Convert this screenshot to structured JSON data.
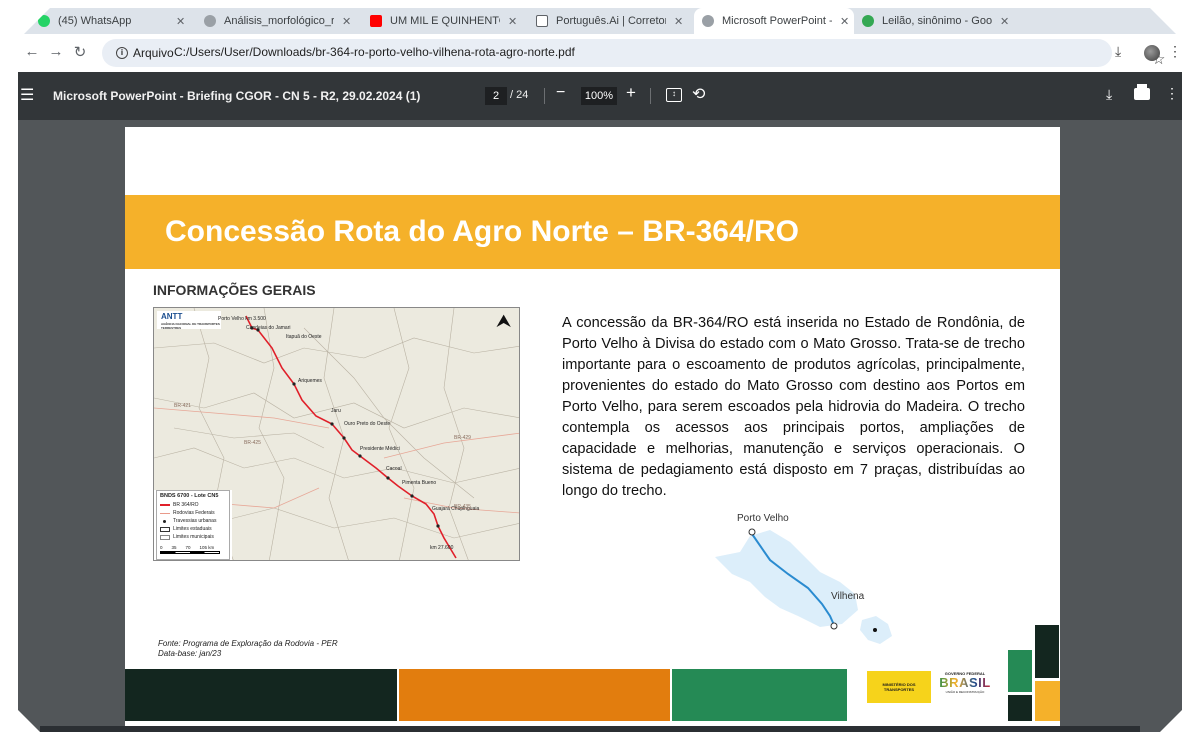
{
  "browser": {
    "tabs": [
      {
        "label": "(45) WhatsApp",
        "icon": "whatsapp-icon",
        "color": "#25d366"
      },
      {
        "label": "Análisis_morfológico_re",
        "icon": "globe-icon",
        "color": "#5f6368"
      },
      {
        "label": "UM MIL E QUINHENTO",
        "icon": "youtube-icon",
        "color": "#ff0000"
      },
      {
        "label": "Português.Ai | Corretor",
        "icon": "document-icon",
        "color": "#5f6368"
      },
      {
        "label": "Microsoft PowerPoint -",
        "icon": "globe-icon",
        "color": "#5f6368",
        "active": true
      },
      {
        "label": "Leilão, sinônimo - Goog",
        "icon": "search-icon",
        "color": "#34a853"
      }
    ],
    "site_chip": "Arquivo",
    "url": "C:/Users/User/Downloads/br-364-ro-porto-velho-vilhena-rota-agro-norte.pdf"
  },
  "pdf_viewer": {
    "title": "Microsoft PowerPoint - Briefing CGOR - CN 5 - R2, 29.02.2024 (1)",
    "page_current": "2",
    "page_total": "/ 24",
    "zoom": "100%"
  },
  "slide": {
    "title": "Concessão Rota do Agro Norte – BR-364/RO",
    "section_heading": "INFORMAÇÕES GERAIS",
    "body": "A concessão da BR-364/RO está inserida no Estado de Rondônia, de Porto Velho à Divisa do estado com o Mato Grosso.  Trata-se de trecho importante para o escoamento de produtos agrícolas, principalmente, provenientes do estado do Mato Grosso com destino aos Portos em Porto Velho, para serem escoados pela hidrovia do Madeira. O trecho contempla os acessos aos principais portos, ampliações de capacidade e melhorias, manutenção e serviços operacionais. O sistema de pedagiamento está disposto em 7 praças,  distribuídas ao longo do trecho.",
    "map": {
      "logo": "ANTT",
      "logo_sub": "AGÊNCIA NACIONAL DE TRANSPORTES TERRESTRES",
      "legend_title": "BNDS 6700 - Lote CN5",
      "legend_items": [
        {
          "label": "BR 364/RO",
          "color": "#e0202a"
        },
        {
          "label": "Rodovias Federais",
          "color": "#e99a8a"
        },
        {
          "label": "Travessias urbanas",
          "color": "#222222"
        },
        {
          "label": "Limites estaduais",
          "color": "#333333"
        },
        {
          "label": "Limites municipais",
          "color": "#888888"
        }
      ],
      "scale_labels": [
        "0",
        "35",
        "70",
        "105 km"
      ],
      "places": [
        "Porto Velho km 3.500",
        "Candeias do Jamari",
        "Itapuã do Oeste",
        "Ariquemes",
        "Jaru",
        "Ouro Preto do Oeste",
        "Presidente Médici",
        "Cacoal",
        "Pimenta Bueno",
        "Guajará Chupinguaia",
        "km 27.600",
        "BR-421",
        "BR-425",
        "BR-429",
        "BR-435"
      ]
    },
    "mini_map_labels": {
      "start": "Porto Velho",
      "end": "Vilhena"
    },
    "source": "Fonte: Programa de Exploração da Rodovia - PER",
    "data_base": "Data-base: jan/23",
    "logo_ministerio": "MINISTÉRIO DOS TRANSPORTES",
    "logo_governo": "GOVERNO FEDERAL",
    "logo_brasil": "BRASIL",
    "logo_uniao": "UNIÃO E RECONSTRUÇÃO"
  },
  "colors": {
    "title_bar": "#f5b12a",
    "band_dark": "#13261f",
    "band_orange": "#e27d0e",
    "band_green": "#258a55",
    "route_red": "#e0202a",
    "mini_map_water": "#2a8bd0"
  }
}
